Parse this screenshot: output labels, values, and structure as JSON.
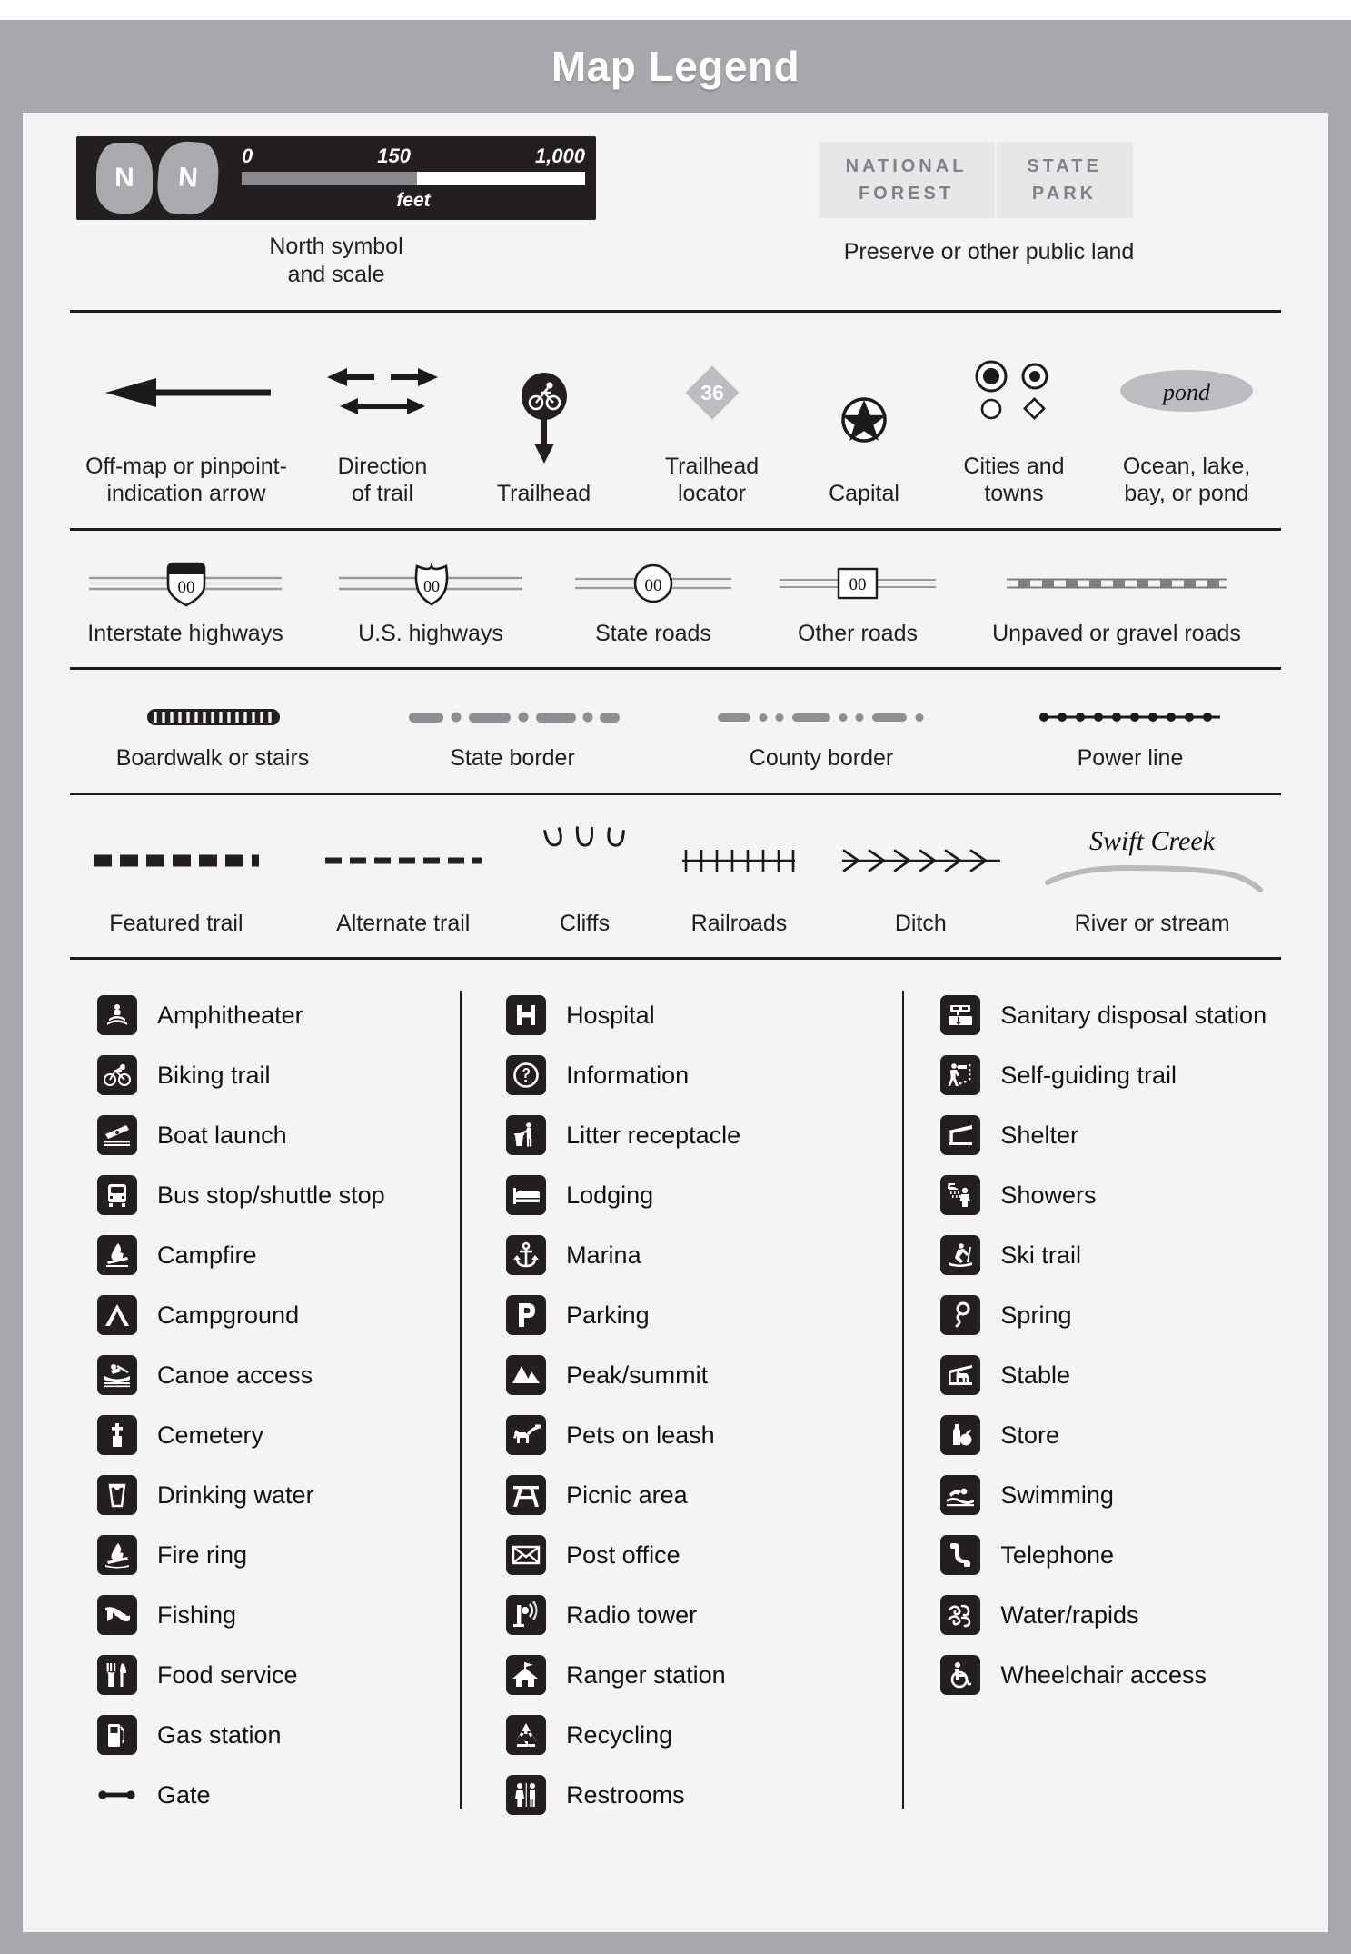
{
  "header": {
    "title": "Map Legend"
  },
  "north": {
    "rose_letter_1": "N",
    "rose_letter_2": "N",
    "scale_min": "0",
    "scale_mid": "150",
    "scale_max": "1,000",
    "scale_unit": "feet",
    "caption_line1": "North symbol",
    "caption_line2": "and scale"
  },
  "preserve": {
    "box1_line1": "NATIONAL",
    "box1_line2": "FOREST",
    "box2_line1": "STATE",
    "box2_line2": "PARK",
    "caption": "Preserve or other public land"
  },
  "symbols_row": [
    {
      "label": "Off-map or pinpoint-\nindication arrow",
      "icon": "offmap-arrow-icon"
    },
    {
      "label": "Direction\nof trail",
      "icon": "direction-of-trail-icon"
    },
    {
      "label": "Trailhead",
      "icon": "trailhead-icon"
    },
    {
      "label": "Trailhead\nlocator",
      "icon": "trailhead-locator-icon",
      "number": "36"
    },
    {
      "label": "Capital",
      "icon": "capital-star-icon"
    },
    {
      "label": "Cities and\ntowns",
      "icon": "cities-and-towns-icon"
    },
    {
      "label": "Ocean, lake,\nbay, or pond",
      "icon": "pond-icon",
      "text": "pond"
    }
  ],
  "roads_row": [
    {
      "label": "Interstate highways",
      "shield": "00",
      "icon": "interstate-shield-icon"
    },
    {
      "label": "U.S. highways",
      "shield": "00",
      "icon": "us-highway-shield-icon"
    },
    {
      "label": "State roads",
      "shield": "00",
      "icon": "state-road-circle-icon"
    },
    {
      "label": "Other roads",
      "shield": "00",
      "icon": "other-road-box-icon"
    },
    {
      "label": "Unpaved or gravel roads",
      "icon": "unpaved-road-icon"
    }
  ],
  "lines_row": [
    {
      "label": "Boardwalk or stairs",
      "icon": "boardwalk-icon"
    },
    {
      "label": "State border",
      "icon": "state-border-icon"
    },
    {
      "label": "County border",
      "icon": "county-border-icon"
    },
    {
      "label": "Power line",
      "icon": "power-line-icon"
    }
  ],
  "trails_row": [
    {
      "label": "Featured trail",
      "icon": "featured-trail-icon"
    },
    {
      "label": "Alternate trail",
      "icon": "alternate-trail-icon"
    },
    {
      "label": "Cliffs",
      "icon": "cliffs-icon"
    },
    {
      "label": "Railroads",
      "icon": "railroad-icon"
    },
    {
      "label": "Ditch",
      "icon": "ditch-icon"
    },
    {
      "label": "River or stream",
      "icon": "river-icon",
      "stream_name": "Swift Creek"
    }
  ],
  "amenities": {
    "column1": [
      {
        "label": "Amphitheater",
        "icon": "amphitheater-icon"
      },
      {
        "label": "Biking trail",
        "icon": "biking-trail-icon"
      },
      {
        "label": "Boat launch",
        "icon": "boat-launch-icon"
      },
      {
        "label": "Bus stop/shuttle stop",
        "icon": "bus-stop-icon"
      },
      {
        "label": "Campfire",
        "icon": "campfire-icon"
      },
      {
        "label": "Campground",
        "icon": "campground-icon"
      },
      {
        "label": "Canoe access",
        "icon": "canoe-access-icon"
      },
      {
        "label": "Cemetery",
        "icon": "cemetery-icon"
      },
      {
        "label": "Drinking water",
        "icon": "drinking-water-icon"
      },
      {
        "label": "Fire ring",
        "icon": "fire-ring-icon"
      },
      {
        "label": "Fishing",
        "icon": "fishing-icon"
      },
      {
        "label": "Food service",
        "icon": "food-service-icon"
      },
      {
        "label": "Gas station",
        "icon": "gas-station-icon"
      },
      {
        "label": "Gate",
        "icon": "gate-icon"
      }
    ],
    "column2": [
      {
        "label": "Hospital",
        "icon": "hospital-icon"
      },
      {
        "label": "Information",
        "icon": "information-icon"
      },
      {
        "label": "Litter receptacle",
        "icon": "litter-receptacle-icon"
      },
      {
        "label": "Lodging",
        "icon": "lodging-icon"
      },
      {
        "label": "Marina",
        "icon": "marina-icon"
      },
      {
        "label": "Parking",
        "icon": "parking-icon"
      },
      {
        "label": "Peak/summit",
        "icon": "peak-summit-icon"
      },
      {
        "label": "Pets on leash",
        "icon": "pets-on-leash-icon"
      },
      {
        "label": "Picnic area",
        "icon": "picnic-area-icon"
      },
      {
        "label": "Post office",
        "icon": "post-office-icon"
      },
      {
        "label": "Radio tower",
        "icon": "radio-tower-icon"
      },
      {
        "label": "Ranger station",
        "icon": "ranger-station-icon"
      },
      {
        "label": "Recycling",
        "icon": "recycling-icon"
      },
      {
        "label": "Restrooms",
        "icon": "restrooms-icon"
      }
    ],
    "column3": [
      {
        "label": "Sanitary disposal station",
        "icon": "sanitary-disposal-icon"
      },
      {
        "label": "Self-guiding trail",
        "icon": "self-guiding-trail-icon"
      },
      {
        "label": "Shelter",
        "icon": "shelter-icon"
      },
      {
        "label": "Showers",
        "icon": "showers-icon"
      },
      {
        "label": "Ski trail",
        "icon": "ski-trail-icon"
      },
      {
        "label": "Spring",
        "icon": "spring-icon"
      },
      {
        "label": "Stable",
        "icon": "stable-icon"
      },
      {
        "label": "Store",
        "icon": "store-icon"
      },
      {
        "label": "Swimming",
        "icon": "swimming-icon"
      },
      {
        "label": "Telephone",
        "icon": "telephone-icon"
      },
      {
        "label": "Water/rapids",
        "icon": "water-rapids-icon"
      },
      {
        "label": "Wheelchair access",
        "icon": "wheelchair-access-icon"
      }
    ]
  },
  "colors": {
    "page_bg": "#a8a8ad",
    "card_bg": "#f4f4f4",
    "ink": "#231f20",
    "muted": "#a9aaae"
  }
}
